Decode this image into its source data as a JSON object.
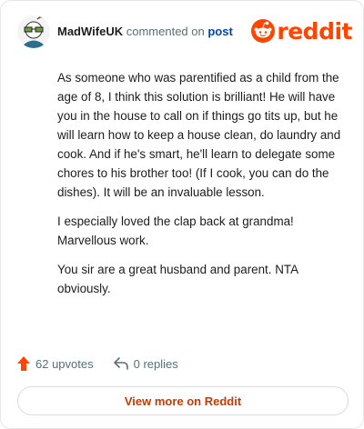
{
  "header": {
    "author": "MadWifeUK",
    "commented_on": "commented on",
    "post_link": "post"
  },
  "brand": {
    "wordmark": "reddit",
    "logo_icon": "reddit-snoo-logo",
    "color": "#ff4500"
  },
  "comment": {
    "paragraphs": [
      "As someone who was parentified as a child from the age of 8, I think this solution is brilliant! He will have you in the house to call on if things go tits up, but he will learn how to keep a house clean, do laundry and cook. And if he's smart, he'll learn to delegate some chores to his brother too! (If I cook, you can do the dishes). It will be an invaluable lesson.",
      "I especially loved the clap back at grandma! Marvellous work.",
      "You sir are a great husband and parent. NTA obviously."
    ]
  },
  "footer": {
    "upvotes": "62 upvotes",
    "replies": "0 replies",
    "upvote_icon": "upvote-arrow-icon",
    "reply_icon": "reply-arrow-icon"
  },
  "cta": {
    "label": "View more on Reddit"
  },
  "colors": {
    "accent": "#ff4500",
    "link": "#0045ac",
    "muted": "#576f76"
  }
}
